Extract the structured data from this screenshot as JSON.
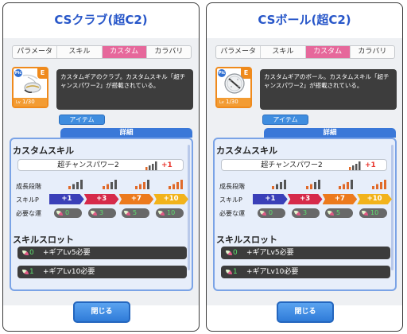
{
  "colors": {
    "title": "#2857c9",
    "active_tab": "#e6689b",
    "accent": "#3a78d8",
    "plus": "#e8332b"
  },
  "tabs_labels": [
    "パラメータ",
    "スキル",
    "カスタム",
    "カラバリ"
  ],
  "panels": [
    {
      "title": "CSクラブ(超C2)",
      "tabs": [
        {
          "label": "パラメータ",
          "active": false
        },
        {
          "label": "スキル",
          "active": false
        },
        {
          "label": "カスタム",
          "active": true
        },
        {
          "label": "カラバリ",
          "active": false
        }
      ],
      "card": {
        "icon": "golf-club-icon",
        "badge": "Pic",
        "grade": "E",
        "lv_tag": "Lv",
        "level": "1/30"
      },
      "description": "カスタムギアのクラブ。カスタムスキル「超チャンスパワー2」が搭載されている。",
      "item_button": "アイテム",
      "detail_tab": "詳細",
      "custom_skill": {
        "heading": "カスタムスキル",
        "name": "超チャンスパワー2",
        "bonus": "+1",
        "rows": {
          "stage": "成長段階",
          "skill_p": "スキルP",
          "luck": "必要な運"
        },
        "steps": [
          "+1",
          "+3",
          "+7",
          "+10"
        ],
        "luck": [
          "0",
          "3",
          "5",
          "10"
        ]
      },
      "skill_slot": {
        "heading": "スキルスロット",
        "slots": [
          {
            "count": "0",
            "text": "+ギアLv5必要"
          },
          {
            "count": "1",
            "text": "+ギアLv10必要"
          }
        ]
      },
      "close_button": "閉じる"
    },
    {
      "title": "CSボール(超C2)",
      "tabs": [
        {
          "label": "パラメータ",
          "active": false
        },
        {
          "label": "スキル",
          "active": false
        },
        {
          "label": "カスタム",
          "active": true
        },
        {
          "label": "カラバリ",
          "active": false
        }
      ],
      "card": {
        "icon": "golf-ball-icon",
        "badge": "Pic",
        "grade": "E",
        "lv_tag": "Lv",
        "level": "1/30"
      },
      "description": "カスタムギアのボール。カスタムスキル「超チャンスパワー2」が搭載されている。",
      "item_button": "アイテム",
      "detail_tab": "詳細",
      "custom_skill": {
        "heading": "カスタムスキル",
        "name": "超チャンスパワー2",
        "bonus": "+1",
        "rows": {
          "stage": "成長段階",
          "skill_p": "スキルP",
          "luck": "必要な運"
        },
        "steps": [
          "+1",
          "+3",
          "+7",
          "+10"
        ],
        "luck": [
          "0",
          "3",
          "5",
          "10"
        ]
      },
      "skill_slot": {
        "heading": "スキルスロット",
        "slots": [
          {
            "count": "0",
            "text": "+ギアLv5必要"
          },
          {
            "count": "1",
            "text": "+ギアLv10必要"
          }
        ]
      },
      "close_button": "閉じる"
    }
  ]
}
